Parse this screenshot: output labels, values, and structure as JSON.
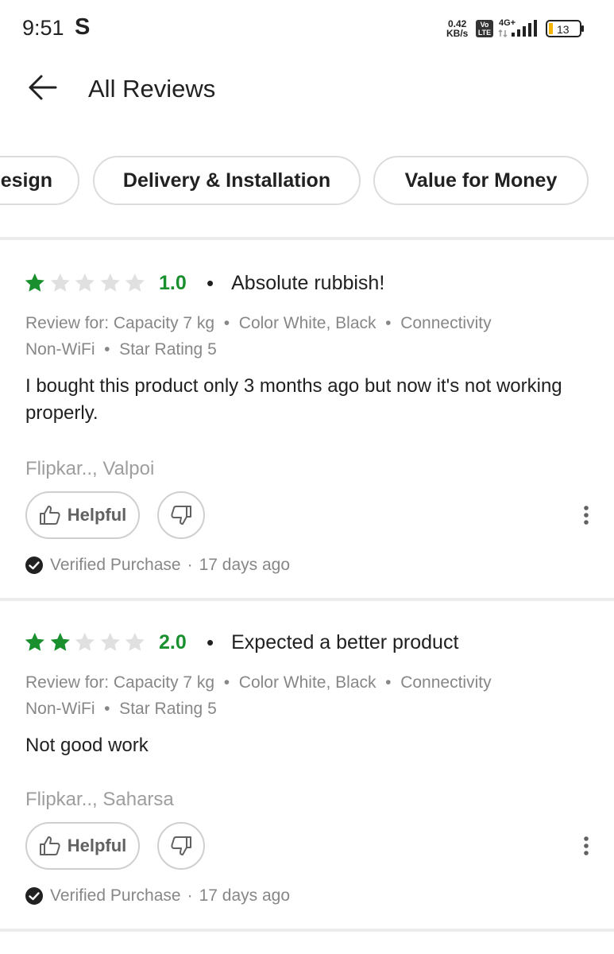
{
  "status_bar": {
    "time": "9:51",
    "app_icon": "S",
    "net_speed_value": "0.42",
    "net_speed_unit": "KB/s",
    "volte_top": "Vo",
    "volte_bottom": "LTE",
    "network": "4G+",
    "battery": "13"
  },
  "header": {
    "title": "All Reviews",
    "back_icon": "arrow-left-icon"
  },
  "chips": [
    {
      "label": "Design"
    },
    {
      "label": "Delivery & Installation"
    },
    {
      "label": "Value for Money"
    }
  ],
  "reviews": [
    {
      "stars_filled": 1,
      "stars_total": 5,
      "rating": "1.0",
      "title": "Absolute rubbish!",
      "review_for_line1": "Review for: Capacity 7 kg  •  Color White, Black  •  Connectivity",
      "review_for_line2": "Non-WiFi  •  Star Rating 5",
      "body": "I bought this product only 3 months ago but now it's not working properly.",
      "reviewer": "Flipkar.., Valpoi",
      "helpful_label": "Helpful",
      "verified_label": "Verified Purchase",
      "age": "17 days ago"
    },
    {
      "stars_filled": 2,
      "stars_total": 5,
      "rating": "2.0",
      "title": "Expected a better product",
      "review_for_line1": "Review for: Capacity 7 kg  •  Color White, Black  •  Connectivity",
      "review_for_line2": "Non-WiFi  •  Star Rating 5",
      "body": "Not good work",
      "reviewer": "Flipkar.., Saharsa",
      "helpful_label": "Helpful",
      "verified_label": "Verified Purchase",
      "age": "17 days ago"
    }
  ],
  "colors": {
    "star_filled": "#1a8f2e",
    "star_empty": "#e0e0e0",
    "rating_text": "#1a8f2e",
    "meta_text": "#878787"
  }
}
